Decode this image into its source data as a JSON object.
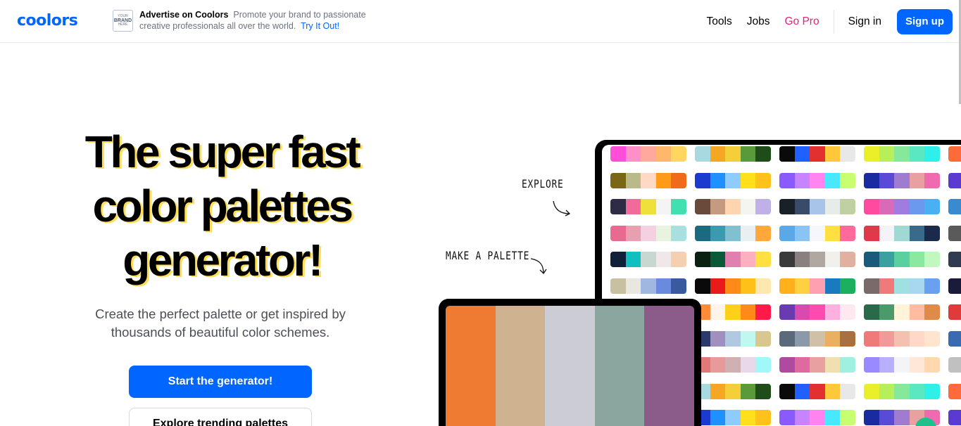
{
  "header": {
    "logo": "coolors",
    "ad": {
      "logo_top": "YOUR",
      "logo_mid": "BRAND",
      "logo_bot": "HERE",
      "brand": "Advertise on Coolors",
      "text": "Promote your brand to passionate creative professionals all over the world.",
      "cta": "Try It Out!"
    },
    "nav": {
      "tools": "Tools",
      "jobs": "Jobs",
      "gopro": "Go Pro",
      "signin": "Sign in",
      "signup": "Sign up"
    }
  },
  "hero": {
    "title_line1": "The super fast",
    "title_line2": "color palettes",
    "title_line3": "generator!",
    "subtitle_line1": "Create the perfect palette or get inspired by",
    "subtitle_line2": "thousands of beautiful color schemes.",
    "primary_button": "Start the generator!",
    "secondary_button": "Explore trending palettes"
  },
  "annotations": {
    "explore": "EXPLORE",
    "make": "MAKE A PALETTE"
  },
  "colors": {
    "accent": "#0066ff",
    "gopro": "#e1237c"
  },
  "front_palette": [
    "#ef7b32",
    "#cfb290",
    "#cbccd4",
    "#8aa69f",
    "#8b5b8a"
  ],
  "palette_grid": [
    [
      [
        "#ff4fd8",
        "#ff8fc8",
        "#ffa89e",
        "#ffb86b",
        "#ffd760"
      ],
      [
        "#a8d8e0",
        "#f5a623",
        "#f4cf3a",
        "#5a9a3a",
        "#1f4d1a"
      ],
      [
        "#0a0a0a",
        "#2060ff",
        "#e23030",
        "#ffc83a",
        "#e8e8e8"
      ],
      [
        "#e9f02a",
        "#b6ef5a",
        "#86e89a",
        "#5ae8c0",
        "#2ef0e8"
      ],
      [
        "#ff6a3a"
      ]
    ],
    [
      [
        "#7b6616",
        "#b9b98a",
        "#ffd9c4",
        "#ff9a1a",
        "#f06a1a"
      ],
      [
        "#1a3ad0",
        "#1e90ff",
        "#8ecbff",
        "#ffe01a",
        "#ffc21a"
      ],
      [
        "#8a5aff",
        "#c784ff",
        "#ff84f0",
        "#48e8ff",
        "#c8ff70"
      ],
      [
        "#1a2aa0",
        "#5a4ad8",
        "#a07cd0",
        "#e8a0a0",
        "#f06ab0"
      ],
      [
        "#5a3ad0"
      ]
    ],
    [
      [
        "#2d2b45",
        "#f06a9a",
        "#f0e03a",
        "#f4f4f4",
        "#40e0b0"
      ],
      [
        "#6a4a3a",
        "#c49a80",
        "#ffd4b0",
        "#f4f4f0",
        "#c0b0e8"
      ],
      [
        "#1a2028",
        "#3a4a6a",
        "#a8c4e8",
        "#e8ece8",
        "#c0d0a0"
      ],
      [
        "#ff4aa0",
        "#d86ab8",
        "#a07ce0",
        "#6a9aee",
        "#4ab0f4"
      ],
      [
        "#3a8ad0"
      ]
    ],
    [
      [
        "#e86a90",
        "#e8a0b0",
        "#f4d0e0",
        "#e8f4e0",
        "#a8e0e0"
      ],
      [
        "#1a6a80",
        "#3a9ab0",
        "#80c0d0",
        "#e8f0f4",
        "#ffa83a"
      ],
      [
        "#5aa8e8",
        "#88c4f4",
        "#f4f8fc",
        "#ffe040",
        "#ff6a9a"
      ],
      [
        "#e03a4a",
        "#f4f4f8",
        "#a0d8d4",
        "#3a6a8a",
        "#1a2a4a"
      ],
      [
        "#5a5a5a"
      ]
    ],
    [
      [
        "#10203a",
        "#10c0c0",
        "#c8d8d0",
        "#f0e8e8",
        "#f4d0b0"
      ],
      [
        "#0a2010",
        "#0a5a3a",
        "#e080b0",
        "#ffb0c0",
        "#ffe040"
      ],
      [
        "#3a3a3a",
        "#8a8080",
        "#b0a8a0",
        "#f0f0ec",
        "#e0b0a0"
      ],
      [
        "#1a5a7a",
        "#3aa0a0",
        "#5ad0a0",
        "#8ae8a0",
        "#c0f8c0"
      ],
      [
        "#303a50"
      ]
    ],
    [
      [
        "#c8c0a0",
        "#e8e8e0",
        "#a0b8e0",
        "#6a8ae0",
        "#3a5aa0"
      ],
      [
        "#0a0a0a",
        "#e81a1a",
        "#ff8a1a",
        "#ffc01a",
        "#ffe8b0"
      ],
      [
        "#ffb01a",
        "#ffd040",
        "#ffa0b0",
        "#1a7ac0",
        "#1ab060"
      ],
      [
        "#7a6a6a",
        "#f07a7a",
        "#a0e0e0",
        "#a8d8f0",
        "#6aa0f0"
      ],
      [
        "#1a1a3a"
      ]
    ],
    [
      [
        "#ffffff",
        "#ffffff",
        "#ffffff",
        "#ffffff",
        "#ffffff"
      ],
      [
        "#ff8a3a",
        "#fff4e8",
        "#ffd01a",
        "#ff8a1a",
        "#ff1a4a"
      ],
      [
        "#6a3ab0",
        "#d84ab0",
        "#ff4ab0",
        "#ffb0e0",
        "#ffe8f0"
      ],
      [
        "#2a6a4a",
        "#4a9a6a",
        "#fff4d8",
        "#ffbca0",
        "#e08a4a"
      ],
      [
        "#e03a3a"
      ]
    ],
    [
      [
        "#ffffff",
        "#ffffff",
        "#ffffff",
        "#ffffff",
        "#ffffff"
      ],
      [
        "#2a3a6a",
        "#a090c0",
        "#b0c8e0",
        "#c0f8f0",
        "#d8c890"
      ],
      [
        "#5a6a7a",
        "#8a9aaa",
        "#d0c0a8",
        "#e8b060",
        "#a87040"
      ],
      [
        "#f07a7a",
        "#f09a9a",
        "#f4c0b0",
        "#ffd8c8",
        "#ffe4d0"
      ],
      [
        "#3a6ab0"
      ]
    ],
    [
      [
        "#ffffff",
        "#ffffff",
        "#ffffff",
        "#ffffff",
        "#ffffff"
      ],
      [
        "#e07a7a",
        "#e89a9a",
        "#d0b0b0",
        "#e8d8e8",
        "#a0f8f8"
      ],
      [
        "#b04aa0",
        "#e06aa0",
        "#e8a0a0",
        "#f0e0b0",
        "#a0f0e0"
      ],
      [
        "#9a8aff",
        "#b8b0ff",
        "#f4f4f8",
        "#ffe8d8",
        "#ffd8b0"
      ],
      [
        "#c0c0c0"
      ]
    ],
    [
      [
        "#ffffff",
        "#ffffff",
        "#ffffff",
        "#ffffff",
        "#ffffff"
      ],
      [
        "#a8d8e0",
        "#f5a623",
        "#f4cf3a",
        "#5a9a3a",
        "#1f4d1a"
      ],
      [
        "#0a0a0a",
        "#2060ff",
        "#e23030",
        "#ffc83a",
        "#e8e8e8"
      ],
      [
        "#e9f02a",
        "#b6ef5a",
        "#86e89a",
        "#5ae8c0",
        "#2ef0e8"
      ],
      [
        "#ff6a3a"
      ]
    ],
    [
      [
        "#ffffff",
        "#ffffff",
        "#ffffff",
        "#ffffff",
        "#ffffff"
      ],
      [
        "#1a3ad0",
        "#1e90ff",
        "#8ecbff",
        "#ffe01a",
        "#ffc21a"
      ],
      [
        "#8a5aff",
        "#c784ff",
        "#ff84f0",
        "#48e8ff",
        "#c8ff70"
      ],
      [
        "#1a2aa0",
        "#5a4ad8",
        "#a07cd0",
        "#e8a0a0",
        "#f06ab0"
      ],
      [
        "#5a3ad0"
      ]
    ]
  ]
}
